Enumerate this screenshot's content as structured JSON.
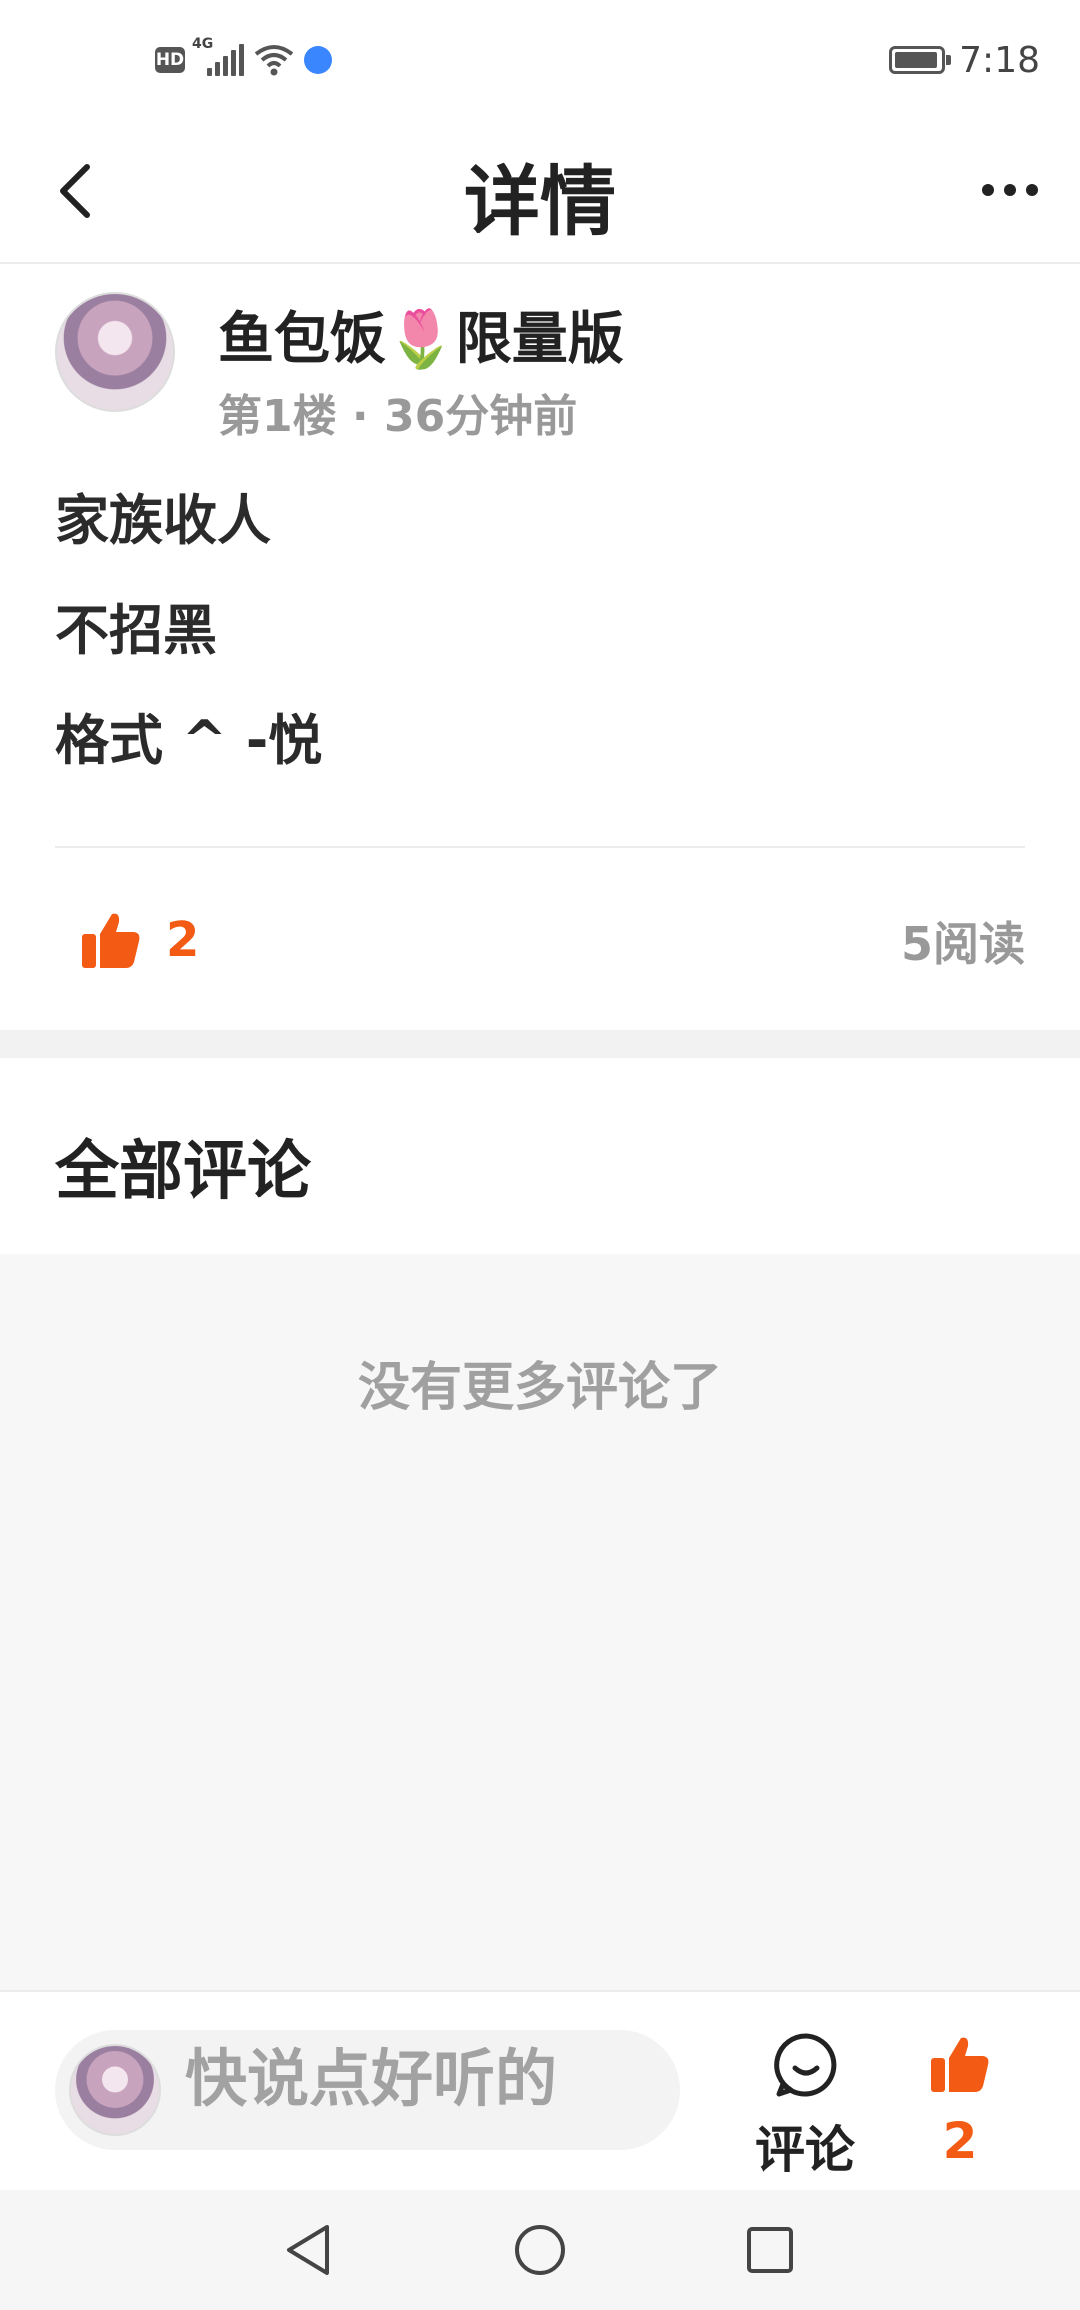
{
  "status_bar": {
    "hd_label": "HD",
    "network_label": "4G",
    "battery_level": 0.95,
    "time": "7:18"
  },
  "nav": {
    "title": "详情",
    "back_icon": "chevron-left-icon",
    "more_icon": "more-dots-icon"
  },
  "post": {
    "author": "鱼包饭",
    "author_emoji": "🌷",
    "author_suffix": "限量版",
    "meta": "第1楼 · 36分钟前",
    "lines": [
      "家族收人",
      "不招黑",
      "格式 ^ -悦"
    ],
    "like_count": "2",
    "reads": "5阅读"
  },
  "comments": {
    "section_title": "全部评论",
    "empty_text": "没有更多评论了"
  },
  "bottom_bar": {
    "input_placeholder": "快说点好听的",
    "comment_label": "评论",
    "like_count": "2"
  },
  "colors": {
    "accent": "#f35a14",
    "text_primary": "#222222",
    "text_secondary": "#999999",
    "bg_light": "#f7f7f7"
  }
}
